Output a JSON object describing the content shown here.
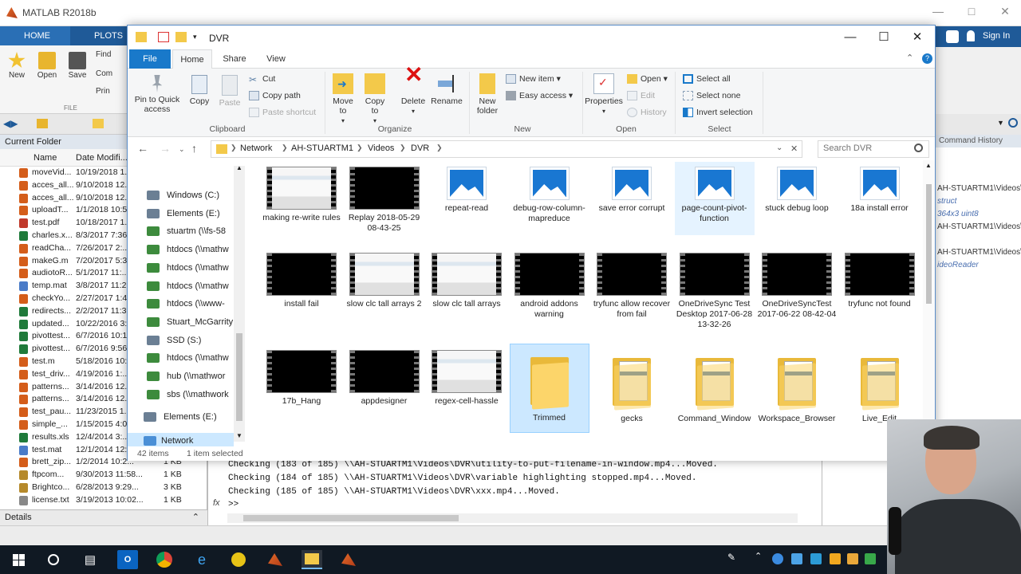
{
  "matlab": {
    "title": "MATLAB R2018b",
    "tabs": [
      "HOME",
      "PLOTS"
    ],
    "toolstrip": [
      "New",
      "Open",
      "Save",
      "Find",
      "Com",
      "Prin"
    ],
    "toolstrip_section": "FILE",
    "search_hint": "Sign In",
    "current_folder": {
      "title": "Current Folder",
      "col_name": "Name",
      "col_date": "Date Modifi...",
      "files": [
        {
          "name": "moveVid...",
          "date": "10/19/2018 1...",
          "size": "",
          "color": "#d45d1a"
        },
        {
          "name": "acces_all...",
          "date": "9/10/2018 12...",
          "size": "",
          "color": "#d45d1a"
        },
        {
          "name": "acces_all...",
          "date": "9/10/2018 12...",
          "size": "",
          "color": "#d45d1a"
        },
        {
          "name": "uploadT...",
          "date": "1/1/2018 10:5...",
          "size": "",
          "color": "#d45d1a"
        },
        {
          "name": "test.pdf",
          "date": "10/18/2017 1...",
          "size": "",
          "color": "#c0392b"
        },
        {
          "name": "charles.x...",
          "date": "8/3/2017 7:36...",
          "size": "",
          "color": "#1f7a3a"
        },
        {
          "name": "readCha...",
          "date": "7/26/2017 2:...",
          "size": "",
          "color": "#d45d1a"
        },
        {
          "name": "makeG.m",
          "date": "7/20/2017 5:3...",
          "size": "",
          "color": "#d45d1a"
        },
        {
          "name": "audiotoR...",
          "date": "5/1/2017 11:...",
          "size": "",
          "color": "#d45d1a"
        },
        {
          "name": "temp.mat",
          "date": "3/8/2017 11:2...",
          "size": "",
          "color": "#4a7bc8"
        },
        {
          "name": "checkYo...",
          "date": "2/27/2017 1:4...",
          "size": "",
          "color": "#d45d1a"
        },
        {
          "name": "redirects...",
          "date": "2/2/2017 11:3...",
          "size": "",
          "color": "#1f7a3a"
        },
        {
          "name": "updated...",
          "date": "10/22/2016 3:...",
          "size": "",
          "color": "#1f7a3a"
        },
        {
          "name": "pivottest...",
          "date": "6/7/2016 10:1...",
          "size": "",
          "color": "#1f7a3a"
        },
        {
          "name": "pivottest...",
          "date": "6/7/2016 9:56...",
          "size": "",
          "color": "#1f7a3a"
        },
        {
          "name": "test.m",
          "date": "5/18/2016 10:...",
          "size": "",
          "color": "#d45d1a"
        },
        {
          "name": "test_driv...",
          "date": "4/19/2016 1:...",
          "size": "",
          "color": "#d45d1a"
        },
        {
          "name": "patterns...",
          "date": "3/14/2016 12...",
          "size": "",
          "color": "#d45d1a"
        },
        {
          "name": "patterns...",
          "date": "3/14/2016 12...",
          "size": "",
          "color": "#d45d1a"
        },
        {
          "name": "test_pau...",
          "date": "11/23/2015 1...",
          "size": "",
          "color": "#d45d1a"
        },
        {
          "name": "simple_...",
          "date": "1/15/2015 4:0...",
          "size": "",
          "color": "#d45d1a"
        },
        {
          "name": "results.xls",
          "date": "12/4/2014 3:...",
          "size": "",
          "color": "#1f7a3a"
        },
        {
          "name": "test.mat",
          "date": "12/1/2014 12:...",
          "size": "",
          "color": "#4a7bc8"
        },
        {
          "name": "brett_zip...",
          "date": "1/2/2014 10:2...",
          "size": "1 KB",
          "color": "#d45d1a"
        },
        {
          "name": "ftpcom...",
          "date": "9/30/2013 11:58...",
          "size": "1 KB",
          "color": "#b5892b"
        },
        {
          "name": "Brightco...",
          "date": "6/28/2013 9:29...",
          "size": "3 KB",
          "color": "#b5892b"
        },
        {
          "name": "license.txt",
          "date": "3/19/2013 10:02...",
          "size": "1 KB",
          "color": "#888888"
        }
      ],
      "details_label": "Details"
    },
    "command_window": {
      "lines": [
        "Checking (183 of 185) \\\\AH-STUARTM1\\Videos\\DVR\\utility-to-put-filename-in-window.mp4...Moved.",
        "Checking (184 of 185) \\\\AH-STUARTM1\\Videos\\DVR\\variable highlighting stopped.mp4...Moved.",
        "Checking (185 of 185) \\\\AH-STUARTM1\\Videos\\DVR\\xxx.mp4...Moved."
      ],
      "prompt": ">>",
      "fx": "fx"
    },
    "history": {
      "title": "Command History",
      "lines": [
        "AH-STUARTM1\\Videos\\",
        "struct",
        "364x3 uint8",
        "AH-STUARTM1\\Videos\\",
        "AH-STUARTM1\\Videos\\",
        "ideoReader"
      ]
    }
  },
  "explorer": {
    "title": "DVR",
    "tabs": {
      "file": "File",
      "home": "Home",
      "share": "Share",
      "view": "View"
    },
    "ribbon": {
      "clipboard": {
        "pin": "Pin to Quick access",
        "copy": "Copy",
        "paste": "Paste",
        "cut": "Cut",
        "copy_path": "Copy path",
        "paste_shortcut": "Paste shortcut",
        "label": "Clipboard"
      },
      "organize": {
        "move_to": "Move to",
        "copy_to": "Copy to",
        "delete": "Delete",
        "rename": "Rename",
        "label": "Organize"
      },
      "new": {
        "new_folder": "New folder",
        "new_item": "New item",
        "easy_access": "Easy access",
        "label": "New"
      },
      "open": {
        "properties": "Properties",
        "open": "Open",
        "edit": "Edit",
        "history": "History",
        "label": "Open"
      },
      "select": {
        "select_all": "Select all",
        "select_none": "Select none",
        "invert": "Invert selection",
        "label": "Select"
      }
    },
    "breadcrumb": [
      "Network",
      "AH-STUARTM1",
      "Videos",
      "DVR"
    ],
    "search_placeholder": "Search DVR",
    "nav_pane": [
      {
        "label": "Windows (C:)",
        "color": "#6b7f94"
      },
      {
        "label": "Elements (E:)",
        "color": "#6b7f94"
      },
      {
        "label": "stuartm (\\\\fs-58",
        "color": "#3d8b3d"
      },
      {
        "label": "htdocs (\\\\mathw",
        "color": "#3d8b3d"
      },
      {
        "label": "htdocs (\\\\mathw",
        "color": "#3d8b3d"
      },
      {
        "label": "htdocs (\\\\mathw",
        "color": "#3d8b3d"
      },
      {
        "label": "htdocs (\\\\www-",
        "color": "#3d8b3d"
      },
      {
        "label": "Stuart_McGarrity",
        "color": "#3d8b3d"
      },
      {
        "label": "SSD (S:)",
        "color": "#6b7f94"
      },
      {
        "label": "htdocs (\\\\mathw",
        "color": "#3d8b3d"
      },
      {
        "label": "hub (\\\\mathwor",
        "color": "#3d8b3d"
      },
      {
        "label": "sbs (\\\\mathwork",
        "color": "#3d8b3d"
      }
    ],
    "nav_elements": "Elements (E:)",
    "nav_network": "Network",
    "items_row1": [
      {
        "label": "making re-write rules",
        "kind": "screen"
      },
      {
        "label": "Replay 2018-05-29 08-43-25",
        "kind": "video"
      },
      {
        "label": "repeat-read",
        "kind": "image"
      },
      {
        "label": "debug-row-column-mapreduce",
        "kind": "image"
      },
      {
        "label": "save error corrupt",
        "kind": "image"
      },
      {
        "label": "page-count-pivot-function",
        "kind": "image"
      },
      {
        "label": "stuck debug loop",
        "kind": "image"
      },
      {
        "label": "18a install error",
        "kind": "image"
      }
    ],
    "items_row2": [
      {
        "label": "install fail",
        "kind": "video"
      },
      {
        "label": "slow clc tall arrays 2",
        "kind": "screen"
      },
      {
        "label": "slow clc tall arrays",
        "kind": "screen"
      },
      {
        "label": "android addons warning",
        "kind": "video"
      },
      {
        "label": "tryfunc allow recover from fail",
        "kind": "video"
      },
      {
        "label": "OneDriveSync Test Desktop 2017-06-28 13-32-26",
        "kind": "video"
      },
      {
        "label": "OneDriveSyncTest 2017-06-22 08-42-04",
        "kind": "video"
      },
      {
        "label": "tryfunc not found",
        "kind": "video"
      }
    ],
    "items_row3": [
      {
        "label": "17b_Hang",
        "kind": "video"
      },
      {
        "label": "appdesigner",
        "kind": "video"
      },
      {
        "label": "regex-cell-hassle",
        "kind": "screen"
      },
      {
        "label": "Trimmed",
        "kind": "folder"
      },
      {
        "label": "gecks",
        "kind": "folder-doc"
      },
      {
        "label": "Command_Window",
        "kind": "folder-doc"
      },
      {
        "label": "Workspace_Browser",
        "kind": "folder-doc"
      },
      {
        "label": "Live_Edit",
        "kind": "folder-doc"
      }
    ],
    "status": {
      "count": "42 items",
      "selected": "1 item selected"
    }
  },
  "colors": {
    "accent": "#1979ca",
    "selection": "#cce8ff",
    "matlab_blue": "#1f5a98"
  }
}
